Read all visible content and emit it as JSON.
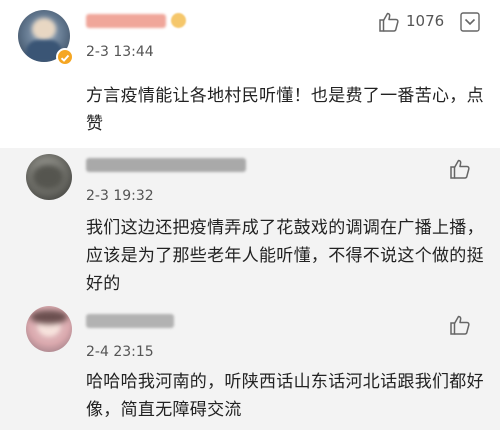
{
  "comments": [
    {
      "time": "2-3 13:44",
      "like_count": "1076",
      "text": "方言疫情能让各地村民听懂！也是费了一番苦心，点赞"
    },
    {
      "time": "2-3 19:32",
      "text": "我们这边还把疫情弄成了花鼓戏的调调在广播上播，应该是为了那些老年人能听懂，不得不说这个做的挺好的"
    },
    {
      "time": "2-4 23:15",
      "text": "哈哈哈我河南的，听陕西话山东话河北话跟我们都好像，简直无障碍交流"
    }
  ],
  "icons": {
    "like": "thumbs-up-icon",
    "more": "more-options-icon",
    "badge": "verified-badge-icon"
  },
  "colors": {
    "badge": "#f5a623",
    "divider": "#dcdcdc",
    "highlight_bg": "#f3f3f3"
  }
}
